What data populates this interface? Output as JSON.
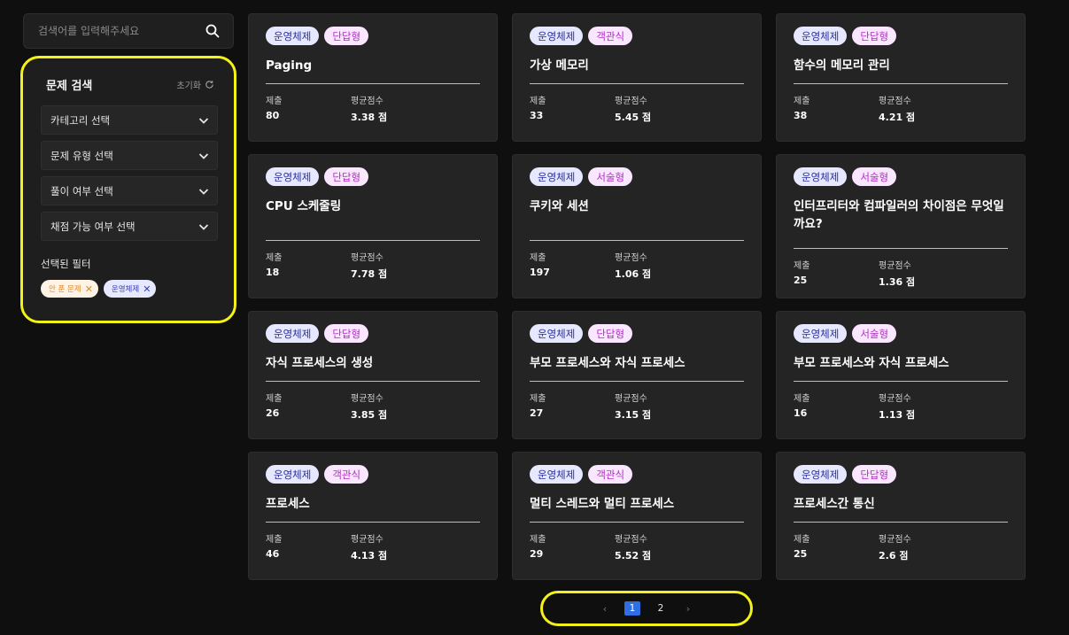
{
  "search": {
    "placeholder": "검색어를 입력해주세요"
  },
  "filter": {
    "title": "문제 검색",
    "reset_label": "초기화",
    "selects": [
      "카테고리 선택",
      "문제 유형 선택",
      "풀이 여부 선택",
      "채점 가능 여부 선택"
    ],
    "selected_label": "선택된 필터",
    "chips": [
      {
        "label": "안 푼 문제",
        "color": "#e08a2a"
      },
      {
        "label": "운영체제",
        "color": "#3a3fb0"
      }
    ]
  },
  "stat_labels": {
    "submit": "제출",
    "avg": "평균점수"
  },
  "cards": [
    {
      "category": "운영체제",
      "type": "단답형",
      "title": "Paging",
      "submit": "80",
      "avg": "3.38 점"
    },
    {
      "category": "운영체제",
      "type": "객관식",
      "title": "가상 메모리",
      "submit": "33",
      "avg": "5.45 점"
    },
    {
      "category": "운영체제",
      "type": "단답형",
      "title": "함수의 메모리 관리",
      "submit": "38",
      "avg": "4.21 점"
    },
    {
      "category": "운영체제",
      "type": "단답형",
      "title": "CPU 스케줄링",
      "submit": "18",
      "avg": "7.78 점"
    },
    {
      "category": "운영체제",
      "type": "서술형",
      "title": "쿠키와 세션",
      "submit": "197",
      "avg": "1.06 점"
    },
    {
      "category": "운영체제",
      "type": "서술형",
      "title": "인터프리터와 컴파일러의 차이점은 무엇일까요?",
      "submit": "25",
      "avg": "1.36 점"
    },
    {
      "category": "운영체제",
      "type": "단답형",
      "title": "자식 프로세스의 생성",
      "submit": "26",
      "avg": "3.85 점"
    },
    {
      "category": "운영체제",
      "type": "단답형",
      "title": "부모 프로세스와 자식 프로세스",
      "submit": "27",
      "avg": "3.15 점"
    },
    {
      "category": "운영체제",
      "type": "서술형",
      "title": "부모 프로세스와 자식 프로세스",
      "submit": "16",
      "avg": "1.13 점"
    },
    {
      "category": "운영체제",
      "type": "객관식",
      "title": "프로세스",
      "submit": "46",
      "avg": "4.13 점"
    },
    {
      "category": "운영체제",
      "type": "객관식",
      "title": "멀티 스레드와 멀티 프로세스",
      "submit": "29",
      "avg": "5.52 점"
    },
    {
      "category": "운영체제",
      "type": "단답형",
      "title": "프로세스간 통신",
      "submit": "25",
      "avg": "2.6 점"
    }
  ],
  "pagination": {
    "prev": "‹",
    "pages": [
      "1",
      "2"
    ],
    "current": "1",
    "next": "›"
  },
  "colors": {
    "highlight": "#f2f21a",
    "active_page": "#2f6fe6",
    "tag_os_bg": "#e6e8ff",
    "tag_type_bg": "#fbe6ff"
  }
}
